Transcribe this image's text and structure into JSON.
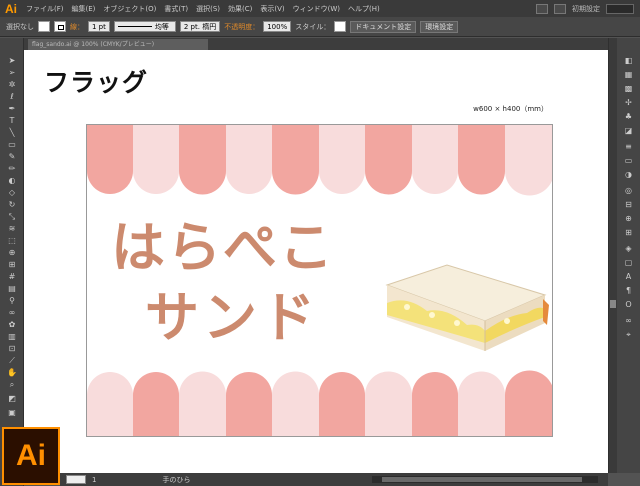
{
  "app": {
    "logo": "Ai",
    "menu": [
      "ファイル(F)",
      "編集(E)",
      "オブジェクト(O)",
      "書式(T)",
      "選択(S)",
      "効果(C)",
      "表示(V)",
      "ウィンドウ(W)",
      "ヘルプ(H)"
    ],
    "workspace": "初期設定"
  },
  "controlbar": {
    "selection": "選択なし",
    "stroke_label": "線：",
    "stroke_weight": "1 pt",
    "line_style": "均等",
    "brush": "2 pt. 楕円",
    "opacity_label": "不透明度：",
    "opacity_value": "100%",
    "style_label": "スタイル：",
    "doc_settings": "ドキュメント設定",
    "preferences": "環境設定"
  },
  "document": {
    "tab_title": "flag_sando.ai @ 100% (CMYK/プレビュー)"
  },
  "canvas": {
    "title": "フラッグ",
    "size_label": "w600 × h400（mm）",
    "flag_line1": "はらぺこ",
    "flag_line2": "サンド"
  },
  "statusbar": {
    "zoom": "1",
    "tool_name": "手のひら"
  },
  "colors": {
    "stripe_dark": "#f2a6a0",
    "stripe_light": "#f8dcdc",
    "flag_text": "#cc8a6e",
    "ai_orange": "#ff8f00"
  },
  "icons": {
    "sandwich": "sandwich-illustration"
  }
}
